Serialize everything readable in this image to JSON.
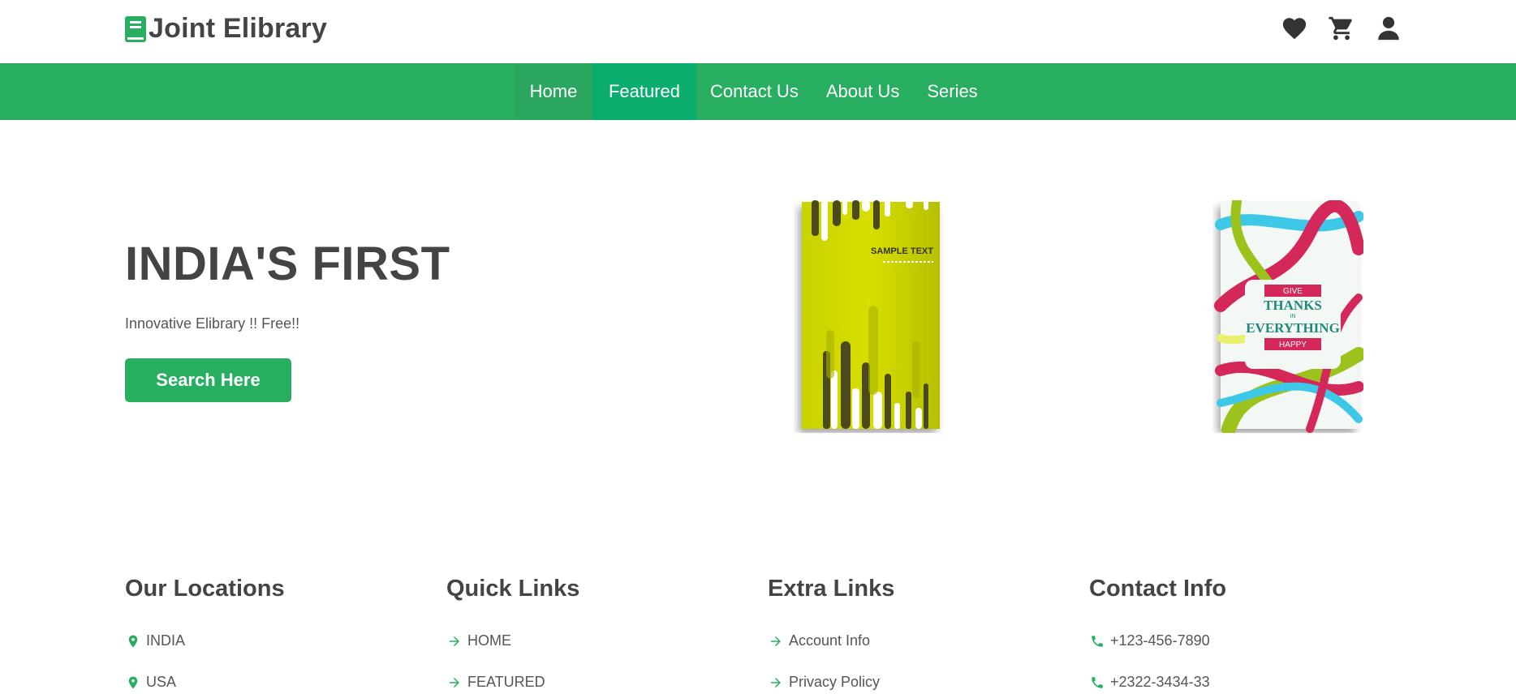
{
  "header": {
    "brand": "Joint Elibrary",
    "icons": [
      "book-icon",
      "heart-icon",
      "cart-icon",
      "user-icon"
    ]
  },
  "nav": {
    "items": [
      "Home",
      "Featured",
      "Contact Us",
      "About Us",
      "Series"
    ]
  },
  "hero": {
    "title": "INDIA'S FIRST",
    "subtitle": "Innovative Elibrary !! Free!!",
    "button": "Search Here"
  },
  "books": [
    {
      "cover_text": "SAMPLE TEXT"
    },
    {
      "cover_lines": [
        "GIVE",
        "THANKS",
        "IN",
        "EVERYTHING",
        "HAPPY"
      ]
    }
  ],
  "footer": {
    "locations": {
      "title": "Our Locations",
      "items": [
        "INDIA",
        "USA"
      ]
    },
    "quick_links": {
      "title": "Quick Links",
      "items": [
        "HOME",
        "FEATURED"
      ]
    },
    "extra_links": {
      "title": "Extra Links",
      "items": [
        "Account Info",
        "Privacy Policy"
      ]
    },
    "contact": {
      "title": "Contact Info",
      "items": [
        "+123-456-7890",
        "+2322-3434-33"
      ]
    }
  },
  "colors": {
    "accent": "#27ae60",
    "nav_active": "#0aad6e",
    "text_dark": "#444444"
  }
}
